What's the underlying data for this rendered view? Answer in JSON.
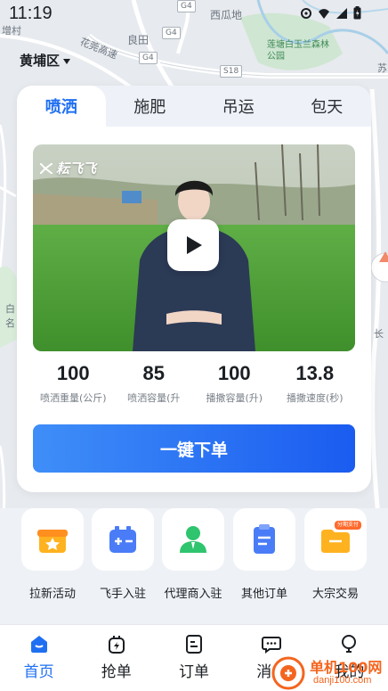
{
  "status_bar": {
    "time": "11:19"
  },
  "map": {
    "places": [
      "增村",
      "西瓜地",
      "良田",
      "花莞高速",
      "莲塘白玉兰森林公园",
      "苏",
      "长",
      "白",
      "名"
    ],
    "roads": [
      "G4",
      "G4",
      "G4",
      "S18"
    ]
  },
  "district": {
    "name": "黄埔区"
  },
  "service_tabs": [
    {
      "label": "喷洒",
      "active": true
    },
    {
      "label": "施肥",
      "active": false
    },
    {
      "label": "吊运",
      "active": false
    },
    {
      "label": "包天",
      "active": false
    }
  ],
  "video": {
    "brand": "耘飞飞"
  },
  "stats": [
    {
      "value": "100",
      "label": "喷洒重量(公斤)"
    },
    {
      "value": "85",
      "label": "喷洒容量(升"
    },
    {
      "value": "100",
      "label": "播撒容量(升)"
    },
    {
      "value": "13.8",
      "label": "播撒速度(秒)"
    }
  ],
  "order_button": {
    "label": "一键下单"
  },
  "features": [
    {
      "label": "拉新活动",
      "icon": "gift-icon",
      "color": "#ffb21f"
    },
    {
      "label": "飞手入驻",
      "icon": "battery-icon",
      "color": "#4a7cf7"
    },
    {
      "label": "代理商入驻",
      "icon": "agent-icon",
      "color": "#2fc46e"
    },
    {
      "label": "其他订单",
      "icon": "clipboard-icon",
      "color": "#4a7cf7"
    },
    {
      "label": "大宗交易",
      "icon": "folder-icon",
      "color": "#ffb21f",
      "tag": "分期支付"
    }
  ],
  "bottom_nav": [
    {
      "label": "首页",
      "icon": "home-icon",
      "active": true
    },
    {
      "label": "抢单",
      "icon": "grab-order-icon",
      "active": false
    },
    {
      "label": "订单",
      "icon": "order-icon",
      "active": false
    },
    {
      "label": "消息",
      "icon": "message-icon",
      "active": false
    },
    {
      "label": "我的",
      "icon": "profile-icon",
      "active": false
    }
  ],
  "watermark": {
    "title": "单机100网",
    "url": "danji100.com"
  },
  "colors": {
    "accent": "#1f6ff2",
    "button_start": "#3f8ef8",
    "button_end": "#1a5cf0"
  }
}
